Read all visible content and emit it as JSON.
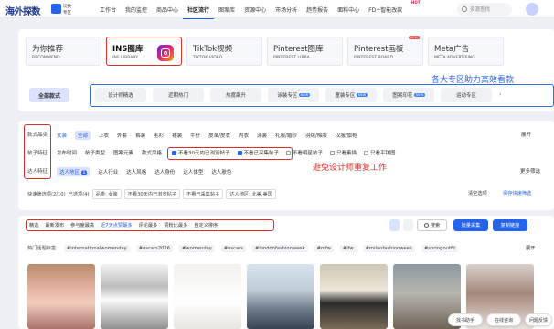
{
  "brand": {
    "logo": "海外探数",
    "switch_line1": "切换",
    "switch_line2": "专区"
  },
  "nav": {
    "items": [
      "工作台",
      "我的监控",
      "商品中心",
      "社区流行",
      "图案库",
      "资源中心",
      "市场分析",
      "趋势报告",
      "面料中心",
      "FD+智能改款"
    ],
    "hot_badge": "HOT",
    "search_placeholder": "资源查找"
  },
  "library_tabs": [
    {
      "title": "为你推荐",
      "sub": "RECOMMEND"
    },
    {
      "title": "INS图库",
      "sub": "INS LIBRARY"
    },
    {
      "title": "TikTok视频",
      "sub": "TIKTOK VIDEO"
    },
    {
      "title": "Pinterest图库",
      "sub": "PINTEREST LIBRA..."
    },
    {
      "title": "Pinterest画板",
      "sub": "PINTEREST BOARD",
      "badge": "NEW"
    },
    {
      "title": "Meta广告",
      "sub": "META ADVERTISING"
    }
  ],
  "annotation_blue": "各大专区助力高效看款",
  "annotation_red": "避免设计师重复工作",
  "all_styles_button": "全部款式",
  "specials": [
    {
      "label": "设计师精选"
    },
    {
      "label": "近期热门"
    },
    {
      "label": "热度飙升"
    },
    {
      "label": "泳装专区",
      "badge": "NEW"
    },
    {
      "label": "童装专区",
      "badge": "NEW"
    },
    {
      "label": "图案印花",
      "badge": "NEW"
    },
    {
      "label": "运动专区"
    }
  ],
  "filter_labels": [
    "款式品类",
    "帖子特征",
    "达人特征"
  ],
  "row1": {
    "selected": "女装",
    "all": "全部",
    "items": [
      "上衣",
      "外套",
      "裤装",
      "毛衫",
      "裙装",
      "牛仔",
      "皮革/皮衣",
      "内衣",
      "泳装",
      "礼服/婚纱",
      "羽绒/棉服",
      "汉服/旗袍"
    ],
    "expand": "展开"
  },
  "row2": {
    "items": [
      "发布时间",
      "帖子类型",
      "图案元素",
      "款式风格"
    ],
    "checks": [
      {
        "label": "不看30天内已浏览帖子",
        "on": true
      },
      {
        "label": "不看已采集帖子",
        "on": true
      },
      {
        "label": "不看明星帖子",
        "on": false
      },
      {
        "label": "只看素描",
        "on": false
      },
      {
        "label": "只看平铺图",
        "on": false
      }
    ]
  },
  "row3": {
    "selected": "达人地区",
    "count": "1",
    "items": [
      "达人行业",
      "达人风格",
      "达人身份",
      "达人体型",
      "达人肤色"
    ],
    "more": "更多筛选"
  },
  "quick": {
    "label": "快速筛选项(2/10)",
    "selected_label": "已选项(4)",
    "tags": [
      "品类: 女装",
      "不看30天内已浏览帖子",
      "不看已采集帖子",
      "达人地区: 北美,美国"
    ],
    "clear": "清空选项",
    "save": "保存快速筛选"
  },
  "sort": {
    "items": [
      "精选",
      "最新发布",
      "参与度最高",
      "近7天点赞最多",
      "评论最多",
      "赞粉比最多",
      "自定义排序"
    ],
    "search_btn": "搜索",
    "bulk_btn": "批量采集",
    "copy_btn": "复制链接"
  },
  "hot_tags": {
    "label": "热门话题标签:",
    "tags": [
      "#internationalwomenday",
      "#oscars2026",
      "#womenday",
      "#oscars",
      "#londonfashionweek",
      "#mfw",
      "#lfw",
      "#milanfashionweek",
      "#springoutfit"
    ],
    "more": "展开"
  },
  "floating": {
    "find": "找书助手",
    "chat": "在线咨询",
    "feedback": "问题反馈"
  }
}
